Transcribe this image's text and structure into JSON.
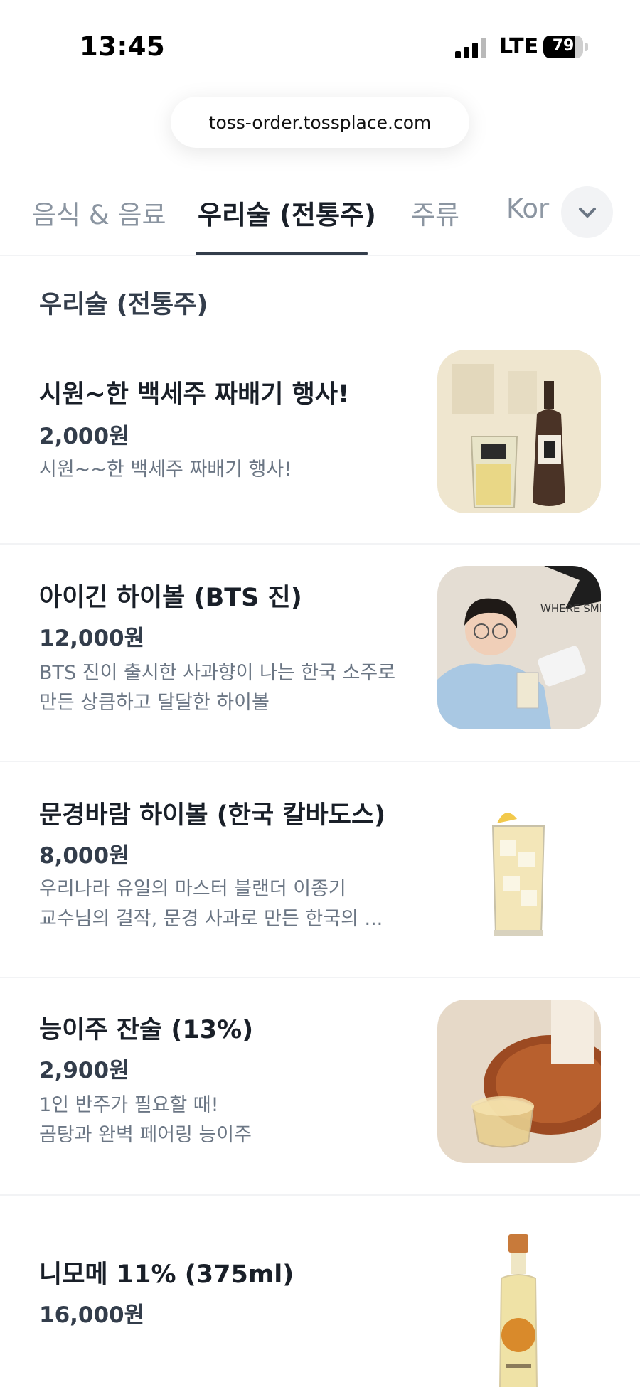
{
  "status_bar": {
    "time": "13:45",
    "network": "LTE",
    "battery": "79",
    "battery_level": 0.79
  },
  "browser": {
    "url": "toss-order.tossplace.com"
  },
  "tabs": [
    {
      "label": "음식 & 음료",
      "active": false
    },
    {
      "label": "우리술 (전통주)",
      "active": true
    },
    {
      "label": "주류",
      "active": false
    },
    {
      "label": "Kor",
      "active": false
    }
  ],
  "tabs_more_icon": "chevron-down-icon",
  "section": {
    "title": "우리술 (전통주)"
  },
  "items": [
    {
      "name": "시원~한 백세주 짜배기 행사!",
      "price": "2,000원",
      "desc": [
        "시원~~한 백세주 짜배기 행사!"
      ],
      "image_icon": "baeksaeju-bottle-glass-image"
    },
    {
      "name": "아이긴 하이볼 (BTS 진)",
      "price": "12,000원",
      "desc": [
        "BTS 진이 출시한 사과향이 나는 한국 소주로",
        "만든 상큼하고 달달한 하이볼"
      ],
      "image_icon": "bts-jin-highball-photo",
      "image_text": "WHERE SMILES BE"
    },
    {
      "name": "문경바람 하이볼 (한국 칼바도스)",
      "price": "8,000원",
      "desc": [
        "우리나라 유일의 마스터 블랜더 이종기",
        "교수님의 걸작, 문경 사과로 만든 한국의 ..."
      ],
      "image_icon": "highball-glass-image"
    },
    {
      "name": "능이주 잔술 (13%)",
      "price": "2,900원",
      "desc": [
        "1인 반주가 필요할 때!",
        "곰탕과 완벽 페어링 능이주"
      ],
      "image_icon": "neungiju-glass-photo"
    },
    {
      "name": "니모메 11% (375ml)",
      "price": "16,000원",
      "desc": [],
      "image_icon": "nimome-bottle-image"
    }
  ],
  "colors": {
    "text_primary": "#191f28",
    "text_secondary": "#6b7684",
    "tab_inactive": "#8b95a1",
    "divider": "#f2f3f5"
  }
}
